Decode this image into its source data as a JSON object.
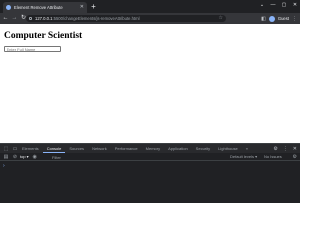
{
  "browser": {
    "tab": {
      "title": "Element Remove Attribute",
      "close": "✕"
    },
    "new_tab": "+",
    "window_controls": [
      "⌄",
      "—",
      "▢",
      "✕"
    ],
    "nav": {
      "back": "←",
      "forward": "→",
      "reload": "↻"
    },
    "address": {
      "host": "127.0.0.1",
      "path": ":5500/changeElements/js-removeAttribute.html"
    },
    "profile_label": "Guest"
  },
  "page": {
    "heading": "Computer Scientist",
    "name_input": {
      "placeholder": "Enter Full Name",
      "value": ""
    }
  },
  "devtools": {
    "tabs": [
      "Elements",
      "Console",
      "Sources",
      "Network",
      "Performance",
      "Memory",
      "Application",
      "Security",
      "Lighthouse",
      "»"
    ],
    "active_tab": "Console",
    "context": "top ▾",
    "filter_placeholder": "Filter",
    "levels": "Default levels ▾",
    "issues": "No Issues",
    "prompt": "›"
  }
}
